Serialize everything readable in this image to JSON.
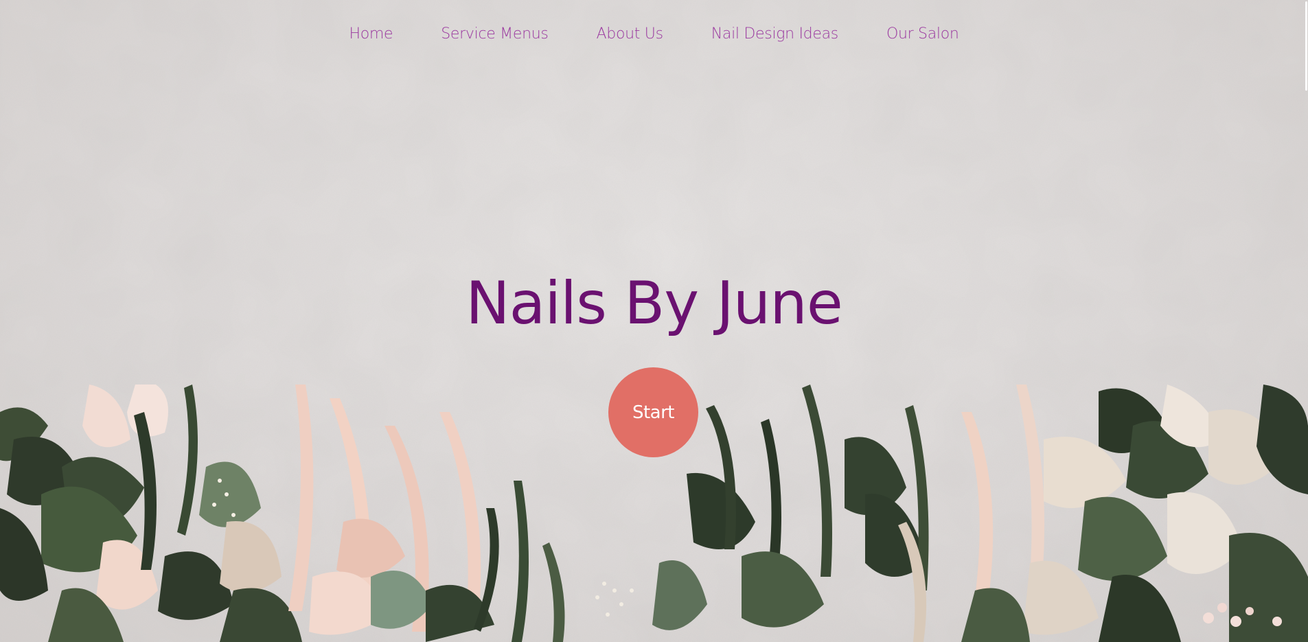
{
  "nav": {
    "items": [
      {
        "label": "Home"
      },
      {
        "label": "Service Menus"
      },
      {
        "label": "About Us"
      },
      {
        "label": "Nail Design Ideas"
      },
      {
        "label": "Our Salon"
      }
    ]
  },
  "hero": {
    "title": "Nails By June",
    "start_label": "Start"
  },
  "colors": {
    "nav_text": "#9b3aa0",
    "title_text": "#6a1170",
    "start_button": "#e16f66",
    "background": "#e0dcdb"
  },
  "icons": {
    "background_image": "concrete-wall-with-foliage"
  }
}
